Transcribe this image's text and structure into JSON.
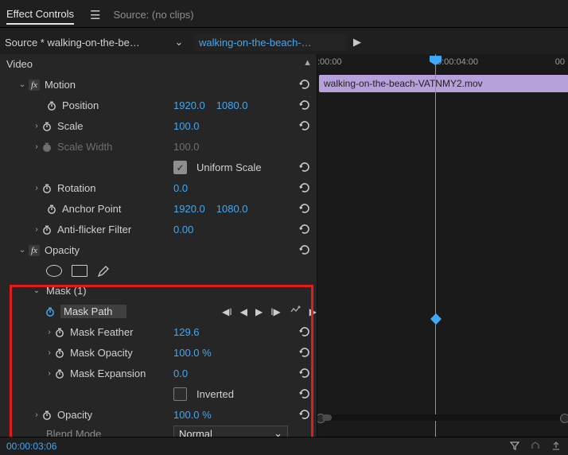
{
  "tabs": {
    "effect_controls": "Effect Controls",
    "source_tab": "Source: (no clips)"
  },
  "source": {
    "left": "Source * walking-on-the-be…",
    "right": "walking-on-the-beach-…"
  },
  "header": {
    "video": "Video"
  },
  "motion": {
    "title": "Motion",
    "position": {
      "label": "Position",
      "x": "1920.0",
      "y": "1080.0"
    },
    "scale": {
      "label": "Scale",
      "value": "100.0"
    },
    "scale_width": {
      "label": "Scale Width",
      "value": "100.0"
    },
    "uniform": {
      "label": "Uniform Scale"
    },
    "rotation": {
      "label": "Rotation",
      "value": "0.0"
    },
    "anchor": {
      "label": "Anchor Point",
      "x": "1920.0",
      "y": "1080.0"
    },
    "antiflicker": {
      "label": "Anti-flicker Filter",
      "value": "0.00"
    }
  },
  "opacity": {
    "title": "Opacity",
    "mask": {
      "title": "Mask (1)",
      "path": "Mask Path",
      "feather": {
        "label": "Mask Feather",
        "value": "129.6"
      },
      "opacity": {
        "label": "Mask Opacity",
        "value": "100.0 %"
      },
      "expansion": {
        "label": "Mask Expansion",
        "value": "0.0"
      },
      "inverted": "Inverted"
    },
    "value": {
      "label": "Opacity",
      "value": "100.0 %"
    },
    "blend": {
      "label": "Blend Mode",
      "value": "Normal"
    }
  },
  "timeline": {
    "ticks": {
      "t0": ":00:00",
      "t1": "0:00:04:00",
      "t2": "00"
    },
    "clip": "walking-on-the-beach-VATNMY2.mov"
  },
  "footer": {
    "timecode": "00:00:03:06"
  },
  "fx_label": "fx"
}
